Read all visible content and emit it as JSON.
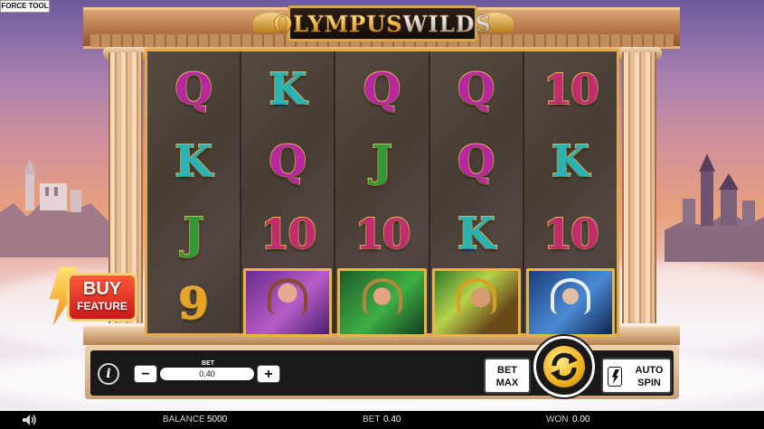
{
  "top_bar": {
    "force_tool_label": "FORCE TOOL"
  },
  "logo": {
    "part1": "OLYMPUS",
    "part2": "WILDS"
  },
  "reels": [
    {
      "symbols": [
        {
          "type": "text",
          "text": "Q",
          "color": "magenta"
        },
        {
          "type": "text",
          "text": "K",
          "color": "teal"
        },
        {
          "type": "text",
          "text": "J",
          "color": "green"
        },
        {
          "type": "text",
          "text": "9",
          "color": "gold"
        }
      ]
    },
    {
      "symbols": [
        {
          "type": "text",
          "text": "K",
          "color": "teal"
        },
        {
          "type": "text",
          "text": "Q",
          "color": "magenta"
        },
        {
          "type": "text",
          "text": "10",
          "color": "pink"
        },
        {
          "type": "portrait",
          "name": "artemis-portrait",
          "theme": "purple"
        }
      ]
    },
    {
      "symbols": [
        {
          "type": "text",
          "text": "Q",
          "color": "magenta"
        },
        {
          "type": "text",
          "text": "J",
          "color": "green"
        },
        {
          "type": "text",
          "text": "10",
          "color": "pink"
        },
        {
          "type": "portrait",
          "name": "athena-portrait",
          "theme": "green"
        }
      ]
    },
    {
      "symbols": [
        {
          "type": "text",
          "text": "Q",
          "color": "magenta"
        },
        {
          "type": "text",
          "text": "Q",
          "color": "magenta"
        },
        {
          "type": "text",
          "text": "K",
          "color": "teal"
        },
        {
          "type": "portrait",
          "name": "hades-portrait",
          "theme": "gold"
        }
      ]
    },
    {
      "symbols": [
        {
          "type": "text",
          "text": "10",
          "color": "pink"
        },
        {
          "type": "text",
          "text": "K",
          "color": "teal"
        },
        {
          "type": "text",
          "text": "10",
          "color": "pink"
        },
        {
          "type": "portrait",
          "name": "poseidon-portrait",
          "theme": "blue"
        }
      ]
    }
  ],
  "colors": {
    "magenta": "#b8279f",
    "teal": "#2ab3b5",
    "green": "#2f9a36",
    "pink": "#c42a6e",
    "gold": "#e8a521",
    "frame": "#e2a94a"
  },
  "buy_feature": {
    "line1": "BUY",
    "line2": "FEATURE"
  },
  "controls": {
    "info_label": "i",
    "bet_label": "BET",
    "bet_value": "0.40",
    "minus_label": "−",
    "plus_label": "+",
    "bet_max_line1": "BET",
    "bet_max_line2": "MAX",
    "auto_spin_line1": "AUTO",
    "auto_spin_line2": "SPIN",
    "spin_icon": "refresh-arrows-icon"
  },
  "status_bar": {
    "balance_label": "BALANCE",
    "balance_value": "5000",
    "bet_label": "BET",
    "bet_value": "0.40",
    "won_label": "WON",
    "won_value": "0.00",
    "sound_icon": "speaker-icon"
  }
}
